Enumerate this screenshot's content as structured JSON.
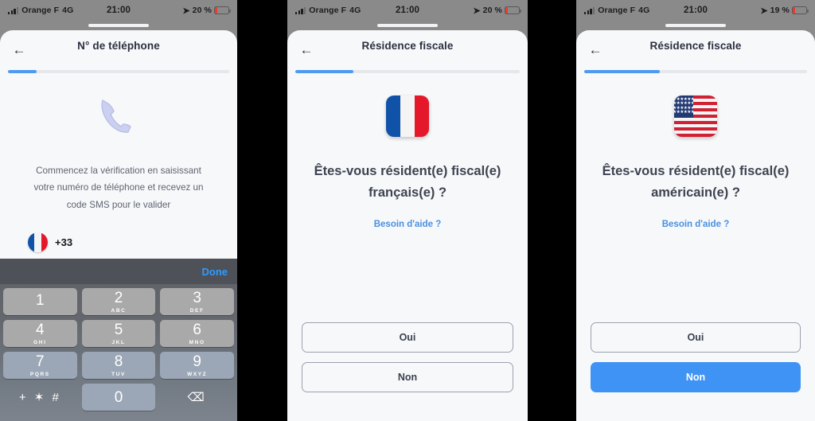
{
  "panels": [
    {
      "id": "phone-number",
      "status": {
        "carrier": "Orange F",
        "network": "4G",
        "time": "21:00",
        "battery_text": "20 %",
        "battery_level": 20,
        "location_icon": "location-arrow-icon"
      },
      "nav": {
        "back_icon": "back-arrow-icon",
        "title": "N° de téléphone"
      },
      "progress": {
        "percent": 13
      },
      "hero_icon": "telephone-handset-icon",
      "intro": "Commencez la vérification en saisissant votre numéro de téléphone et recevez un code SMS pour le valider",
      "input": {
        "flag_icon": "france-flag-icon",
        "dial_code": "+33",
        "value": "",
        "placeholder": ""
      },
      "keyboard": {
        "done_label": "Done",
        "keys": [
          {
            "num": "1",
            "sub": ""
          },
          {
            "num": "2",
            "sub": "ABC"
          },
          {
            "num": "3",
            "sub": "DEF"
          },
          {
            "num": "4",
            "sub": "GHI"
          },
          {
            "num": "5",
            "sub": "JKL"
          },
          {
            "num": "6",
            "sub": "MNO"
          },
          {
            "num": "7",
            "sub": "PQRS"
          },
          {
            "num": "8",
            "sub": "TUV"
          },
          {
            "num": "9",
            "sub": "WXYZ"
          },
          {
            "num": "+ ✶ #",
            "sub": ""
          },
          {
            "num": "0",
            "sub": ""
          },
          {
            "num": "⌫",
            "sub": ""
          }
        ]
      }
    },
    {
      "id": "fiscal-residence-france",
      "status": {
        "carrier": "Orange F",
        "network": "4G",
        "time": "21:00",
        "battery_text": "20 %",
        "battery_level": 20,
        "location_icon": "location-arrow-icon"
      },
      "nav": {
        "back_icon": "back-arrow-icon",
        "title": "Résidence fiscale"
      },
      "progress": {
        "percent": 26
      },
      "hero_icon": "france-flag-icon",
      "question": "Êtes-vous résident(e) fiscal(e) français(e) ?",
      "help_label": "Besoin d'aide ?",
      "buttons": [
        {
          "label": "Oui",
          "selected": false
        },
        {
          "label": "Non",
          "selected": false
        }
      ]
    },
    {
      "id": "fiscal-residence-usa",
      "status": {
        "carrier": "Orange F",
        "network": "4G",
        "time": "21:00",
        "battery_text": "19 %",
        "battery_level": 19,
        "location_icon": "location-arrow-icon"
      },
      "nav": {
        "back_icon": "back-arrow-icon",
        "title": "Résidence fiscale"
      },
      "progress": {
        "percent": 34
      },
      "hero_icon": "usa-flag-icon",
      "question": "Êtes-vous résident(e) fiscal(e) américain(e) ?",
      "help_label": "Besoin d'aide ?",
      "buttons": [
        {
          "label": "Oui",
          "selected": false
        },
        {
          "label": "Non",
          "selected": true
        }
      ]
    }
  ],
  "colors": {
    "accent": "#3f93f5",
    "progress": "#4d9bf0",
    "link": "#4a8fe0",
    "battery_low": "#ec3a2e"
  }
}
